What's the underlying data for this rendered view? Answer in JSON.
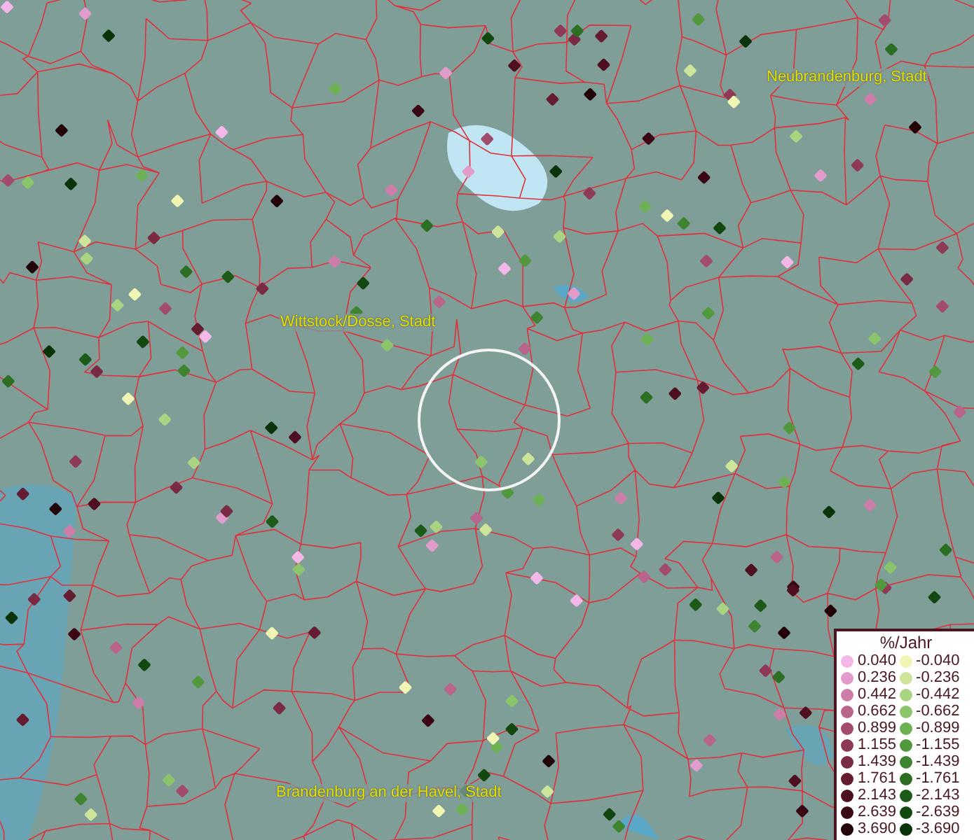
{
  "map": {
    "places": [
      {
        "name": "Neubrandenburg, Stadt",
        "kind": "city"
      },
      {
        "name": "Wittstock/Dosse, Stadt",
        "kind": "city"
      },
      {
        "name": "Brandenburg an der Havel, Stadt",
        "kind": "city"
      }
    ]
  },
  "legend": {
    "title": "%/Jahr",
    "positive": [
      {
        "value": "0.040",
        "color": "#f4b8e8"
      },
      {
        "value": "0.236",
        "color": "#e29ccb"
      },
      {
        "value": "0.442",
        "color": "#cd7ea8"
      },
      {
        "value": "0.662",
        "color": "#b9648a"
      },
      {
        "value": "0.899",
        "color": "#a24b6c"
      },
      {
        "value": "1.155",
        "color": "#8e3a56"
      },
      {
        "value": "1.439",
        "color": "#7a2a42"
      },
      {
        "value": "1.761",
        "color": "#651b30"
      },
      {
        "value": "2.143",
        "color": "#4e0f20"
      },
      {
        "value": "2.639",
        "color": "#3a0714"
      },
      {
        "value": "3.690",
        "color": "#220308"
      }
    ],
    "negative": [
      {
        "value": "-0.040",
        "color": "#f0f5b4"
      },
      {
        "value": "-0.236",
        "color": "#cde59a"
      },
      {
        "value": "-0.442",
        "color": "#a9d583"
      },
      {
        "value": "-0.662",
        "color": "#8cc46c"
      },
      {
        "value": "-0.899",
        "color": "#6eb054"
      },
      {
        "value": "-1.155",
        "color": "#52983c"
      },
      {
        "value": "-1.439",
        "color": "#3f8430"
      },
      {
        "value": "-1.761",
        "color": "#2c6e22"
      },
      {
        "value": "-2.143",
        "color": "#1d5a18"
      },
      {
        "value": "-2.639",
        "color": "#124810"
      },
      {
        "value": "-3.690",
        "color": "#0b3309"
      }
    ]
  }
}
